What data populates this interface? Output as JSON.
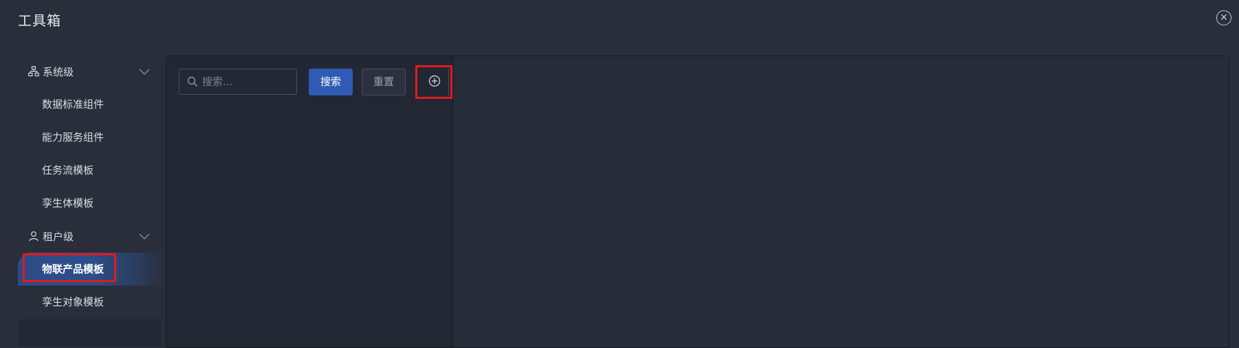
{
  "window": {
    "title": "工具箱",
    "close_icon": "close-circle-icon"
  },
  "sidebar": {
    "groups": [
      {
        "label": "系统级",
        "icon": "hierarchy-icon",
        "items": [
          "数据标准组件",
          "能力服务组件",
          "任务流模板",
          "孪生体模板"
        ]
      },
      {
        "label": "租户级",
        "icon": "user-icon",
        "items": [
          "物联产品模板",
          "孪生对象模板"
        ]
      }
    ],
    "active_item": "物联产品模板"
  },
  "toolbar": {
    "search_placeholder": "搜索...",
    "search_value": "",
    "search_label": "搜索",
    "reset_label": "重置",
    "add_icon": "add-circle-icon"
  },
  "colors": {
    "background": "#292e3a",
    "panel": "#222733",
    "accent": "#2f5bb5",
    "highlight_border": "#e21b1b"
  }
}
